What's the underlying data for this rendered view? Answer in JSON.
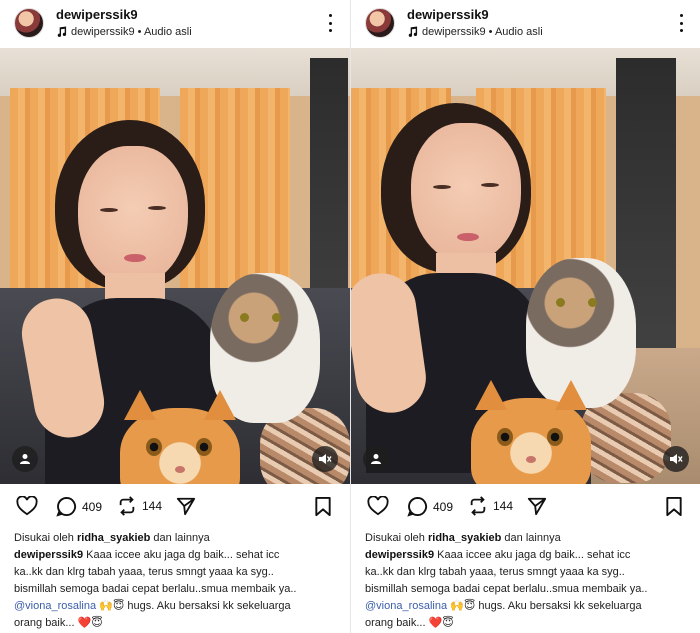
{
  "post": {
    "username": "dewiperssik9",
    "audio_label": "dewiperssik9 • Audio asli",
    "likes_count": "409",
    "reposts_count": "144",
    "liked_by_prefix": "Disukai oleh",
    "liked_by_user": "ridha_syakieb",
    "liked_by_suffix": "dan lainnya",
    "caption_user": "dewiperssik9",
    "caption_line1": "Kaaa iccee aku jaga dg baik... sehat icc",
    "caption_line2": "ka..kk dan klrg tabah yaaa, terus smngt yaaa ka syg..",
    "caption_line3": "bismillah semoga badai cepat berlalu..smua membaik ya..",
    "mention": "@viona_rosalina",
    "caption_line4_rest": "🙌😇 hugs. Aku bersaksi kk sekeluarga",
    "caption_line5": "orang baik... ❤️😇"
  },
  "icons": {
    "more": "more-vertical-icon",
    "heart": "heart-icon",
    "comment": "comment-icon",
    "repost": "repost-icon",
    "share": "share-icon",
    "save": "bookmark-icon",
    "user": "user-tag-icon",
    "mute": "mute-icon",
    "note": "music-note-icon"
  }
}
